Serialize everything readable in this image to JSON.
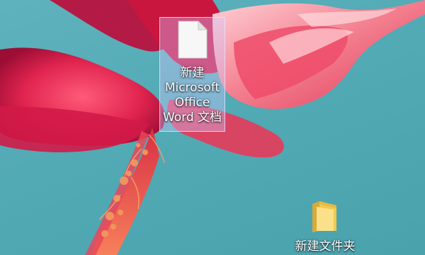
{
  "desktop": {
    "icons": [
      {
        "label": "新建 Microsoft Office Word 文档",
        "icon": "blank-document-icon",
        "selected": true
      },
      {
        "label": "新建文件夹",
        "icon": "folder-icon",
        "selected": false
      }
    ]
  },
  "colors": {
    "sky": "#55aeb9",
    "petal_dark": "#c8144a",
    "petal_bright": "#e8305e",
    "petal_light": "#f27c8c",
    "stamen": "#f0714a",
    "selection": "#d2c8ff",
    "folder": "#f2c94c"
  }
}
